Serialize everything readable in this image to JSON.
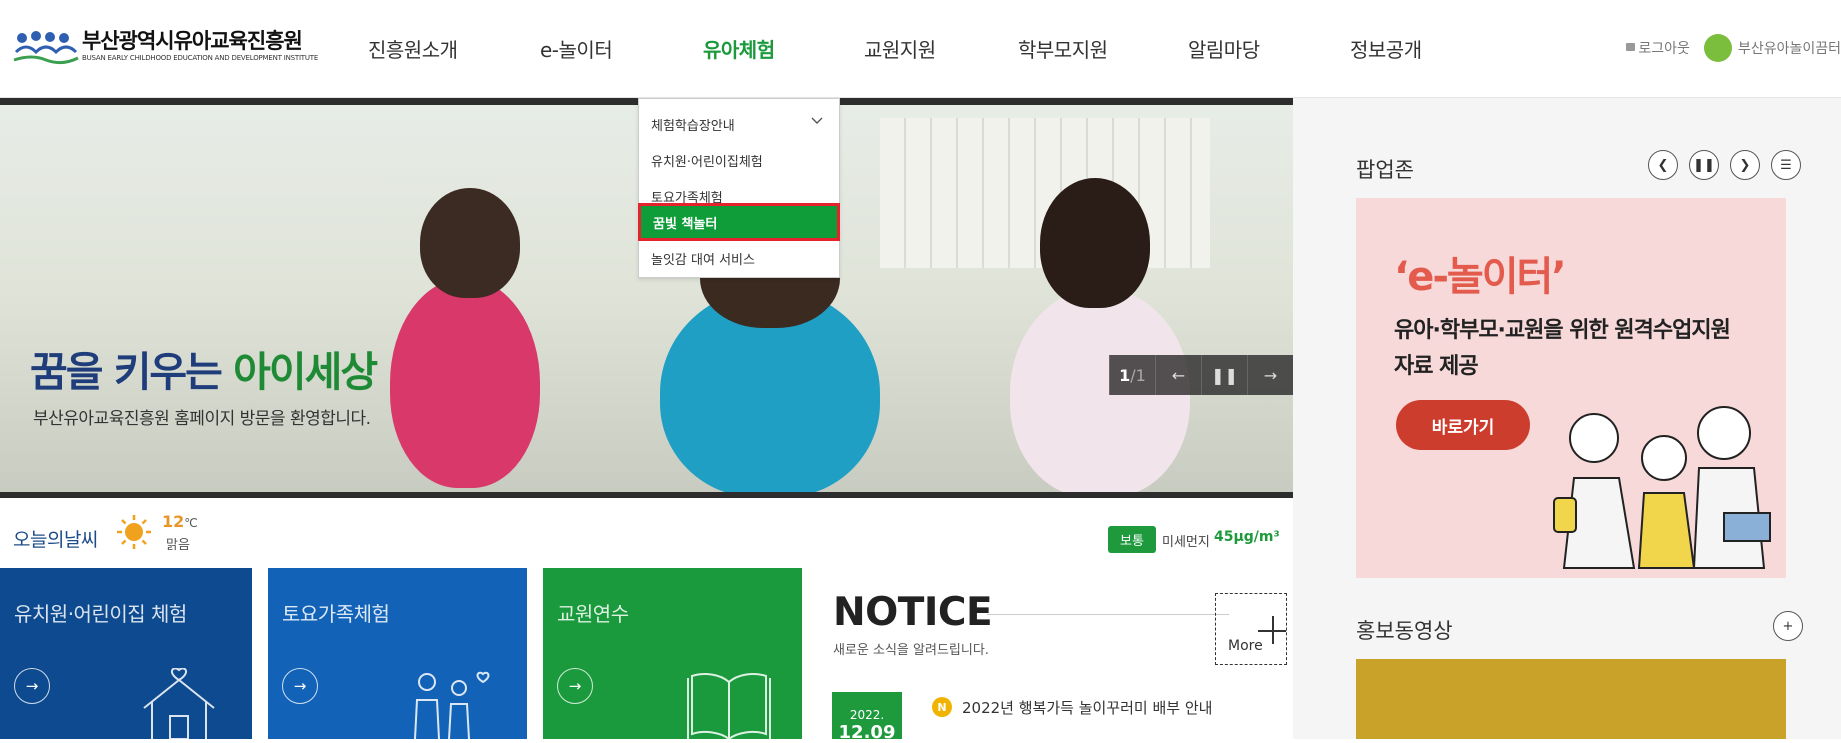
{
  "header": {
    "logo_title": "부산광역시유아교육진흥원",
    "logo_sub": "BUSAN EARLY CHILDHOOD EDUCATION AND DEVELOPMENT INSTITUTE",
    "nav": [
      {
        "label": "진흥원소개"
      },
      {
        "label": "e-놀이터"
      },
      {
        "label": "유아체험",
        "active": true
      },
      {
        "label": "교원지원"
      },
      {
        "label": "학부모지원"
      },
      {
        "label": "알림마당"
      },
      {
        "label": "정보공개"
      }
    ],
    "logout": "로그아웃",
    "playground": "부산유아놀이끔터"
  },
  "dropdown": {
    "items": [
      {
        "label": "체험학습장안내"
      },
      {
        "label": "유치원·어린이집체험"
      },
      {
        "label": "토요가족체험"
      },
      {
        "label": "꿈빛 책놀터",
        "active": true
      },
      {
        "label": "놀잇감 대여 서비스"
      }
    ]
  },
  "hero": {
    "slogan_a": "꿈을 키우는 ",
    "slogan_b": "아이세상",
    "welcome": "부산유아교육진흥원 홈페이지 방문을 환영합니다.",
    "counter_current": "1",
    "counter_total": "/1"
  },
  "weather": {
    "label": "오늘의날씨",
    "temp": "12",
    "unit": "℃",
    "sky": "맑음",
    "dust_badge": "보통",
    "dust_label": "미세먼지",
    "dust_value": "45μg/m³"
  },
  "tiles": [
    {
      "label": "유치원·어린이집 체험",
      "color": "#0d4a8f"
    },
    {
      "label": "토요가족체험",
      "color": "#1262b8"
    },
    {
      "label": "교원연수",
      "color": "#1a9a3c"
    }
  ],
  "notice": {
    "title": "NOTICE",
    "subtitle": "새로운 소식을 알려드립니다.",
    "more": "More",
    "item_year": "2022.",
    "item_day": "12.09",
    "item_badge": "N",
    "item_title": "2022년 행복가득 놀이꾸러미 배부 안내"
  },
  "popup": {
    "title": "팝업존",
    "big": "‘e-놀이터’",
    "line1": "유아·학부모·교원을 위한 원격수업지원",
    "line2": "자료 제공",
    "button": "바로가기"
  },
  "video": {
    "title": "홍보동영상"
  }
}
